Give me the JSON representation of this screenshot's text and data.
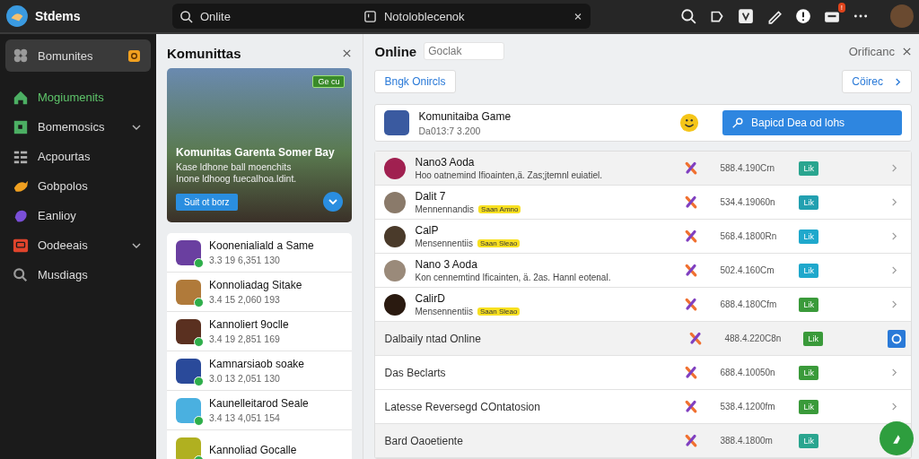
{
  "topbar": {
    "app_name": "Stdems",
    "search_value": "Onlite",
    "document_label": "Notoloblecenok",
    "notification_badge": "!"
  },
  "sidebar": {
    "items": [
      {
        "label": "Bomunites",
        "kind": "puzzle",
        "color": "#9a9a9a",
        "selected": true,
        "badge": true,
        "chevron": false
      },
      {
        "label": "Mogiumenits",
        "kind": "home",
        "color": "#4caf63",
        "selected": false,
        "badge": false,
        "chevron": false,
        "active": true
      },
      {
        "label": "Bomemosics",
        "kind": "square",
        "color": "#4caf63",
        "selected": false,
        "badge": false,
        "chevron": true,
        "active": false
      },
      {
        "label": "Acpourtas",
        "kind": "grid",
        "color": "#b0b0b0",
        "selected": false,
        "badge": false,
        "chevron": false,
        "active": false
      },
      {
        "label": "Gobpolos",
        "kind": "fish",
        "color": "#f0a020",
        "selected": false,
        "badge": false,
        "chevron": false,
        "active": false
      },
      {
        "label": "Eanlioy",
        "kind": "blob",
        "color": "#7a4fd8",
        "selected": false,
        "badge": false,
        "chevron": false,
        "active": false
      },
      {
        "label": "Oodeeais",
        "kind": "tv",
        "color": "#e0442c",
        "selected": false,
        "badge": false,
        "chevron": true,
        "active": false
      },
      {
        "label": "Musdiags",
        "kind": "search",
        "color": "#9a9a9a",
        "selected": false,
        "badge": false,
        "chevron": false,
        "active": false
      }
    ]
  },
  "community_panel": {
    "title": "Komunittas",
    "hero": {
      "badge": "Ge cu",
      "title": "Komunitas Garenta Somer Bay",
      "description": "Kase ldhone ball moenchits\nInone ldhoog fuecalhoa.ldint.",
      "button": "Suit ot borz"
    },
    "games": [
      {
        "name": "Koonenialiald a Same",
        "meta": "3.3 19 6,351 130",
        "color": "#6a3fa0"
      },
      {
        "name": "Konnoliadag Sitake",
        "meta": "3.4 15 2,060 193",
        "color": "#b07a3a"
      },
      {
        "name": "Kannoliert 9oclle",
        "meta": "3.4 19 2,851 169",
        "color": "#5a3020"
      },
      {
        "name": "Kamnarsiaob soake",
        "meta": "3.0 13 2,051 130",
        "color": "#2a4a9a"
      },
      {
        "name": "Kaunelleitarod Seale",
        "meta": "3.4 13 4,051 154",
        "color": "#4ab0e0"
      },
      {
        "name": "Kannoliad Gocalle",
        "color": "#b0b020"
      }
    ]
  },
  "online_panel": {
    "title": "Online",
    "filter_placeholder": "Goclak",
    "header_right": "Orificanc",
    "left_button": "Bngk Onircls",
    "right_button": "Cöirec",
    "featured": {
      "name": "Komunitaiba Game",
      "meta": "Da013:7 3.200",
      "button": "Bapicd Dea od lohs"
    },
    "rows": [
      {
        "kind": "person",
        "name": "Nano3 Aoda",
        "sub": "Hoo oatnemind  Ifioainten,ä. Zas;jtemnl euiatiel.",
        "value": "588.4.190Crn",
        "status": "Lik",
        "color": "#2aa58f",
        "selected": true
      },
      {
        "kind": "person",
        "name": "Dalit 7",
        "sub": "Mennennandis",
        "tag": "Saan Amno",
        "value": "534.4.19060n",
        "status": "Lik",
        "color": "#22a0b0",
        "selected": false
      },
      {
        "kind": "person",
        "name": "CalP",
        "sub": "Mensennentiis",
        "tag": "Saan Sleao",
        "value": "568.4.1800Rn",
        "status": "Lik",
        "color": "#1fa8cc",
        "selected": false
      },
      {
        "kind": "person",
        "name": "Nano 3 Aoda",
        "sub": "Kon cennemtind  Ificainten, ä. 2as. Hannl eotenal.",
        "value": "502.4.160Cm",
        "status": "Lik",
        "color": "#1fa8cc",
        "selected": false
      },
      {
        "kind": "person",
        "name": "CalirD",
        "sub": "Mensennentiis",
        "tag": "Saan Sleao",
        "value": "688.4.180Cfm",
        "status": "Lik",
        "color": "#3a9a3a",
        "selected": false
      },
      {
        "kind": "section",
        "name": "Dalbaily ntad Online",
        "value": "488.4.220C8n",
        "status": "Lik",
        "color": "#3a9a3a",
        "selected": true
      },
      {
        "kind": "section",
        "name": "Das Beclarts",
        "value": "688.4.10050n",
        "status": "Lik",
        "color": "#3a9a3a",
        "selected": false
      },
      {
        "kind": "section",
        "name": "Latesse Reversegd COntatosion",
        "value": "538.4.1200fm",
        "status": "Lik",
        "color": "#3a9a3a",
        "selected": false
      },
      {
        "kind": "section",
        "name": "Bard Oaoetiente",
        "value": "388.4.1800m",
        "status": "Lik",
        "color": "#2aa58f",
        "selected": true
      }
    ]
  }
}
